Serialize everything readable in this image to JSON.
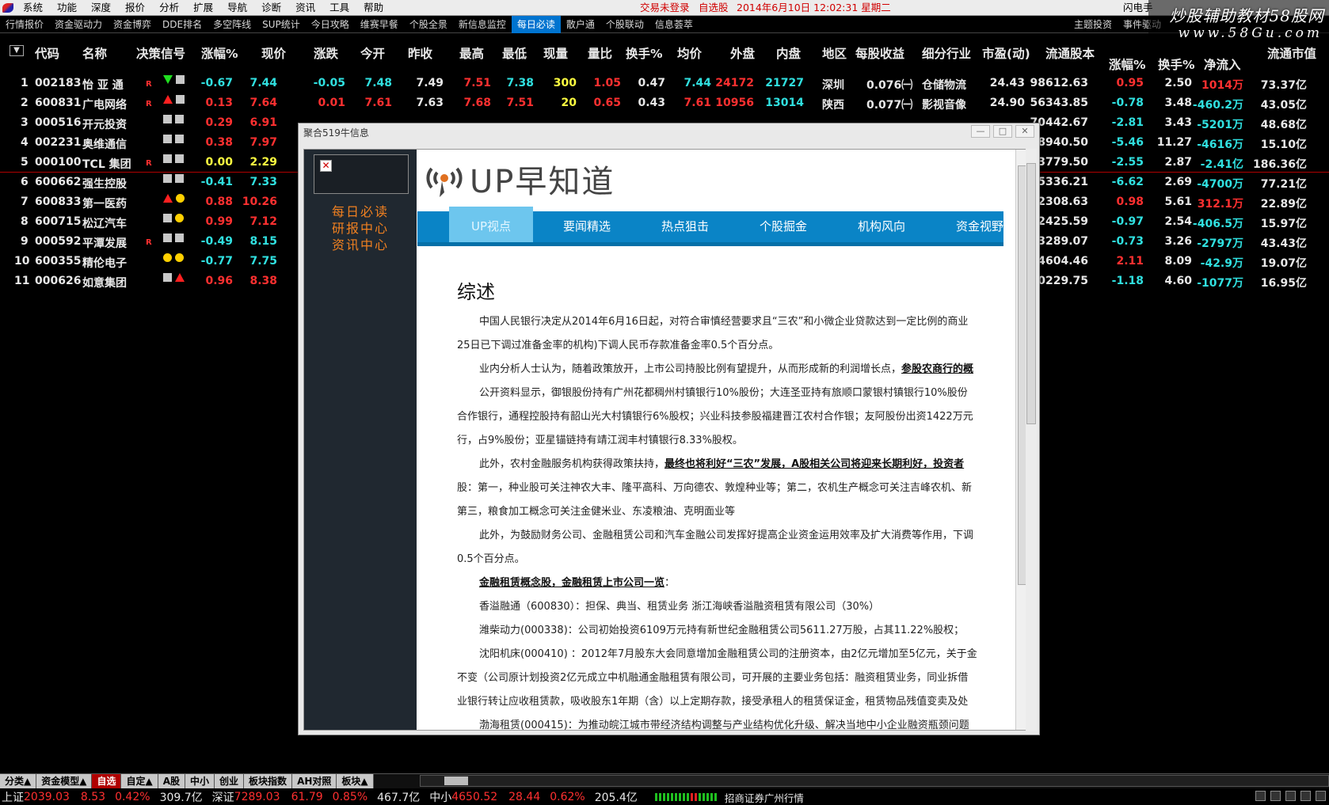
{
  "menu": [
    "系统",
    "功能",
    "深度",
    "报价",
    "分析",
    "扩展",
    "导航",
    "诊断",
    "资讯",
    "工具",
    "帮助"
  ],
  "status": {
    "trade": "交易未登录",
    "watchlist": "自选股",
    "datetime": "2014年6月10日  12:02:31  星期二",
    "flash": "闪电手"
  },
  "subnav": [
    "行情报价",
    "资金驱动力",
    "资金博弈",
    "DDE排名",
    "多空阵线",
    "SUP统计",
    "今日攻略",
    "维赛早餐",
    "个股全景",
    "新信息监控",
    "每日必读",
    "散户通",
    "个股联动",
    "信息荟萃"
  ],
  "subnav_active": "每日必读",
  "subnav_right": [
    "主题投资",
    "事件驱动"
  ],
  "watermark": {
    "line1": "炒股辅助教材58股网",
    "line2": "www.58Gu.com"
  },
  "columns": [
    "代码",
    "名称",
    "决策信号",
    "涨幅%",
    "现价",
    "涨跌",
    "今开",
    "昨收",
    "最高",
    "最低",
    "现量",
    "量比",
    "换手%",
    "均价",
    "外盘",
    "内盘",
    "地区",
    "每股收益",
    "细分行业",
    "市盈(动)",
    "流通股本",
    "涨幅%",
    "换手%",
    "净流入",
    "流通市值"
  ],
  "rows": [
    {
      "n": "1",
      "code": "002183",
      "name": "怡 亚 通",
      "r": "R",
      "sig": [
        "tri-dn",
        "sq"
      ],
      "pct": "-0.67",
      "price": "7.44",
      "chg": "-0.05",
      "open": "7.48",
      "prev": "7.49",
      "high": "7.51",
      "low": "7.38",
      "vol": "300",
      "vr": "1.05",
      "turn": "0.47",
      "avg": "7.44",
      "outer": "24172",
      "inner": "21727",
      "region": "深圳",
      "eps": "0.076㈠",
      "ind": "仓储物流",
      "pe": "24.43",
      "float": "98612.63",
      "pct2": "0.95",
      "turn2": "2.50",
      "net": "1014万",
      "mcap": "73.37亿",
      "d": "dn",
      "d2": "up",
      "d3": "up"
    },
    {
      "n": "2",
      "code": "600831",
      "name": "广电网络",
      "r": "R",
      "sig": [
        "tri-up",
        "sq"
      ],
      "pct": "0.13",
      "price": "7.64",
      "chg": "0.01",
      "open": "7.61",
      "prev": "7.63",
      "high": "7.68",
      "low": "7.51",
      "vol": "20",
      "vr": "0.65",
      "turn": "0.43",
      "avg": "7.61",
      "outer": "10956",
      "inner": "13014",
      "region": "陕西",
      "eps": "0.077㈠",
      "ind": "影视音像",
      "pe": "24.90",
      "float": "56343.85",
      "pct2": "-0.78",
      "turn2": "3.48",
      "net": "-460.2万",
      "mcap": "43.05亿",
      "d": "up",
      "d2": "dn",
      "d3": "dn"
    },
    {
      "n": "3",
      "code": "000516",
      "name": "开元投资",
      "r": "",
      "sig": [
        "sq",
        "sq"
      ],
      "pct": "0.29",
      "price": "6.91",
      "float": "70442.67",
      "pct2": "-2.81",
      "turn2": "3.43",
      "net": "-5201万",
      "mcap": "48.68亿",
      "d": "up",
      "d2": "dn",
      "d3": "dn"
    },
    {
      "n": "4",
      "code": "002231",
      "name": "奥维通信",
      "r": "",
      "sig": [
        "sq",
        "sq"
      ],
      "pct": "0.38",
      "price": "7.97",
      "float": "18940.50",
      "pct2": "-5.46",
      "turn2": "11.27",
      "net": "-4616万",
      "mcap": "15.10亿",
      "d": "up",
      "d2": "dn",
      "d3": "dn"
    },
    {
      "n": "5",
      "code": "000100",
      "name": "TCL 集团",
      "r": "R",
      "sig": [
        "sq",
        "sq"
      ],
      "pct": "0.00",
      "price": "2.29",
      "float": "813779.50",
      "pct2": "-2.55",
      "turn2": "2.87",
      "net": "-2.41亿",
      "mcap": "186.36亿",
      "d": "fl",
      "d2": "dn",
      "d3": "dn"
    },
    {
      "n": "6",
      "code": "600662",
      "name": "强生控股",
      "r": "",
      "sig": [
        "sq",
        "sq"
      ],
      "pct": "-0.41",
      "price": "7.33",
      "float": "105336.21",
      "pct2": "-6.62",
      "turn2": "2.69",
      "net": "-4700万",
      "mcap": "77.21亿",
      "d": "dn",
      "d2": "dn",
      "d3": "dn"
    },
    {
      "n": "7",
      "code": "600833",
      "name": "第一医药",
      "r": "",
      "sig": [
        "tri-up",
        "dot"
      ],
      "pct": "0.88",
      "price": "10.26",
      "float": "22308.63",
      "pct2": "0.98",
      "turn2": "5.61",
      "net": "312.1万",
      "mcap": "22.89亿",
      "d": "up",
      "d2": "up",
      "d3": "up"
    },
    {
      "n": "8",
      "code": "600715",
      "name": "松辽汽车",
      "r": "",
      "sig": [
        "sq",
        "dot"
      ],
      "pct": "0.99",
      "price": "7.12",
      "float": "22425.59",
      "pct2": "-0.97",
      "turn2": "2.54",
      "net": "-406.5万",
      "mcap": "15.97亿",
      "d": "up",
      "d2": "dn",
      "d3": "dn"
    },
    {
      "n": "9",
      "code": "000592",
      "name": "平潭发展",
      "r": "R",
      "sig": [
        "sq",
        "sq"
      ],
      "pct": "-0.49",
      "price": "8.15",
      "float": "53289.07",
      "pct2": "-0.73",
      "turn2": "3.26",
      "net": "-2797万",
      "mcap": "43.43亿",
      "d": "dn",
      "d2": "dn",
      "d3": "dn"
    },
    {
      "n": "10",
      "code": "600355",
      "name": "精伦电子",
      "r": "",
      "sig": [
        "dot",
        "dot"
      ],
      "pct": "-0.77",
      "price": "7.75",
      "float": "24604.46",
      "pct2": "2.11",
      "turn2": "8.09",
      "net": "-42.9万",
      "mcap": "19.07亿",
      "d": "dn",
      "d2": "up",
      "d3": "dn"
    },
    {
      "n": "11",
      "code": "000626",
      "name": "如意集团",
      "r": "",
      "sig": [
        "sq",
        "tri-up"
      ],
      "pct": "0.96",
      "price": "8.38",
      "float": "20229.75",
      "pct2": "-1.18",
      "turn2": "4.60",
      "net": "-1077万",
      "mcap": "16.95亿",
      "d": "up",
      "d2": "dn",
      "d3": "dn"
    }
  ],
  "dialog": {
    "title": "聚合519牛信息",
    "side_links": [
      "每日必读",
      "研报中心",
      "资讯中心"
    ],
    "brand": "UP早知道",
    "tabs": [
      "UP视点",
      "要闻精选",
      "热点狙击",
      "个股掘金",
      "机构风向",
      "资金视野"
    ],
    "heading": "综述",
    "paragraphs": [
      {
        "indent": true,
        "text": "中国人民银行决定从2014年6月16日起，对符合审慎经营要求且“三农”和小微企业贷款达到一定比例的商业"
      },
      {
        "indent": false,
        "text": "25日已下调过准备金率的机构)下调人民币存款准备金率0.5个百分点。"
      },
      {
        "indent": true,
        "text": "业内分析人士认为，随着政策放开，上市公司持股比例有望提升，从而形成新的利润增长点，",
        "bold": "参股农商行的概"
      },
      {
        "indent": true,
        "text": "公开资料显示，御银股份持有广州花都稠州村镇银行10%股份；大连圣亚持有旅顺口蒙银村镇银行10%股份"
      },
      {
        "indent": false,
        "text": "合作银行，通程控股持有韶山光大村镇银行6%股权；兴业科技参股福建晋江农村合作银；友阿股份出资1422万元"
      },
      {
        "indent": false,
        "text": "行，占9%股份；亚星锚链持有靖江润丰村镇银行8.33%股权。"
      },
      {
        "indent": true,
        "text": "此外，农村金融服务机构获得政策扶持，",
        "bold": "最终也将利好“三农”发展，A股相关公司将迎来长期利好，投资者"
      },
      {
        "indent": false,
        "text": "股：第一，种业股可关注神农大丰、隆平高科、万向德农、敦煌种业等；第二，农机生产概念可关注吉峰农机、新"
      },
      {
        "indent": false,
        "text": "第三，粮食加工概念可关注金健米业、东凌粮油、克明面业等"
      },
      {
        "indent": true,
        "text": "此外，为鼓励财务公司、金融租赁公司和汽车金融公司发挥好提高企业资金运用效率及扩大消费等作用，下调"
      },
      {
        "indent": false,
        "text": "0.5个百分点。"
      },
      {
        "indent": true,
        "text": "",
        "bold": "金融租赁概念股，金融租赁上市公司一览",
        "tail": "："
      },
      {
        "indent": true,
        "text": "香溢融通（600830）：担保、典当、租赁业务 浙江海峡香溢融资租赁有限公司（30%）"
      },
      {
        "indent": true,
        "text": "潍柴动力(000338)：公司初始投资6109万元持有新世纪金融租赁公司5611.27万股，占其11.22%股权；"
      },
      {
        "indent": true,
        "text": "沈阳机床(000410) ：2012年7月股东大会同意增加金融租赁公司的注册资本，由2亿元增加至5亿元，关于金"
      },
      {
        "indent": false,
        "text": "不变（公司原计划投资2亿元成立中机融通金融租赁有限公司，可开展的主要业务包括：融资租赁业务，同业拆借"
      },
      {
        "indent": false,
        "text": "业银行转让应收租赁款，吸收股东1年期（含）以上定期存款，接受承租人的租赁保证金，租赁物品残值变卖及处"
      },
      {
        "indent": true,
        "text": "渤海租赁(000415)：为推动皖江城市带经济结构调整与产业结构优化升级、解决当地中小企业融资瓶颈问题"
      }
    ]
  },
  "bottom_tabs": [
    "分类▲",
    "资金模型▲",
    "自选",
    "自定▲",
    "A股",
    "中小",
    "创业",
    "板块指数",
    "AH对照",
    "板块▲"
  ],
  "bottom_tab_active": "自选",
  "ticker": [
    {
      "lbl": "上证",
      "v": "2039.03",
      "c": "8.53",
      "p": "0.42%",
      "amt": "309.7亿"
    },
    {
      "lbl": "深证",
      "v": "7289.03",
      "c": "61.79",
      "p": "0.85%",
      "amt": "467.7亿"
    },
    {
      "lbl": "中小",
      "v": "4650.52",
      "c": "28.44",
      "p": "0.62%",
      "amt": "205.4亿"
    }
  ],
  "broker": "招商证券广州行情"
}
